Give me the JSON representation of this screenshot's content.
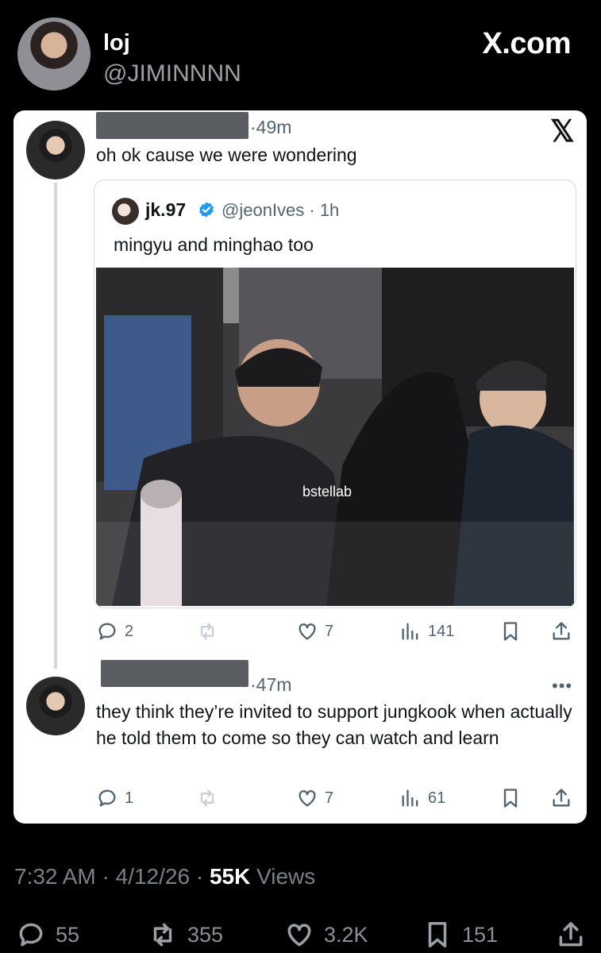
{
  "header": {
    "name": "loj",
    "handle": "@JIMINNNN",
    "brand": "X.com"
  },
  "reply1": {
    "time": "·49m",
    "text": "oh ok cause we were wondering",
    "stats": {
      "replies": "2",
      "likes": "7",
      "views": "141"
    }
  },
  "quote": {
    "name": "jk.97",
    "handle": "@jeonIves · 1h",
    "text": "mingyu and minghao too",
    "watermark": "bstellab"
  },
  "reply2": {
    "time": "·47m",
    "text": "they think they’re invited to support jungkook when actually he told them to come so they can watch and learn",
    "stats": {
      "replies": "1",
      "likes": "7",
      "views": "61"
    }
  },
  "footer": {
    "time": "7:32 AM",
    "date": "4/12/26",
    "views": "55K",
    "views_label": "Views",
    "replies": "55",
    "reposts": "355",
    "likes": "3.2K",
    "bookmarks": "151"
  },
  "colors": {
    "verified": "#1d9bf0",
    "background": "#000000",
    "card": "#ffffff"
  },
  "icons": [
    "reply-icon",
    "repost-icon",
    "like-icon",
    "views-icon",
    "bookmark-icon",
    "share-icon",
    "x-logo-icon",
    "more-icon",
    "verified-badge-icon"
  ]
}
